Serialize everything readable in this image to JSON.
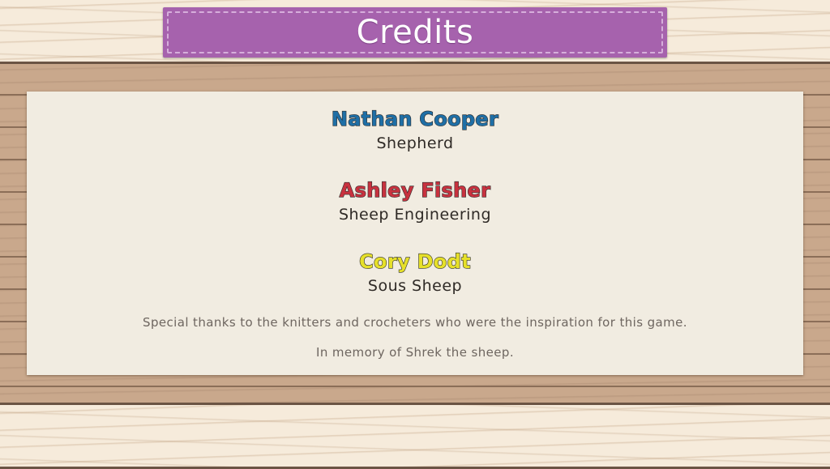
{
  "header": {
    "title": "Credits"
  },
  "credits": [
    {
      "name": "Nathan Cooper",
      "role": "Shepherd",
      "color": "#1f6fa6"
    },
    {
      "name": "Ashley Fisher",
      "role": "Sheep Engineering",
      "color": "#c8323f"
    },
    {
      "name": "Cory Dodt",
      "role": "Sous Sheep",
      "color": "#e6e02a"
    }
  ],
  "notes": {
    "thanks": "Special thanks to the knitters and crocheters who were the inspiration for this game.",
    "memory": "In memory of Shrek the sheep."
  }
}
